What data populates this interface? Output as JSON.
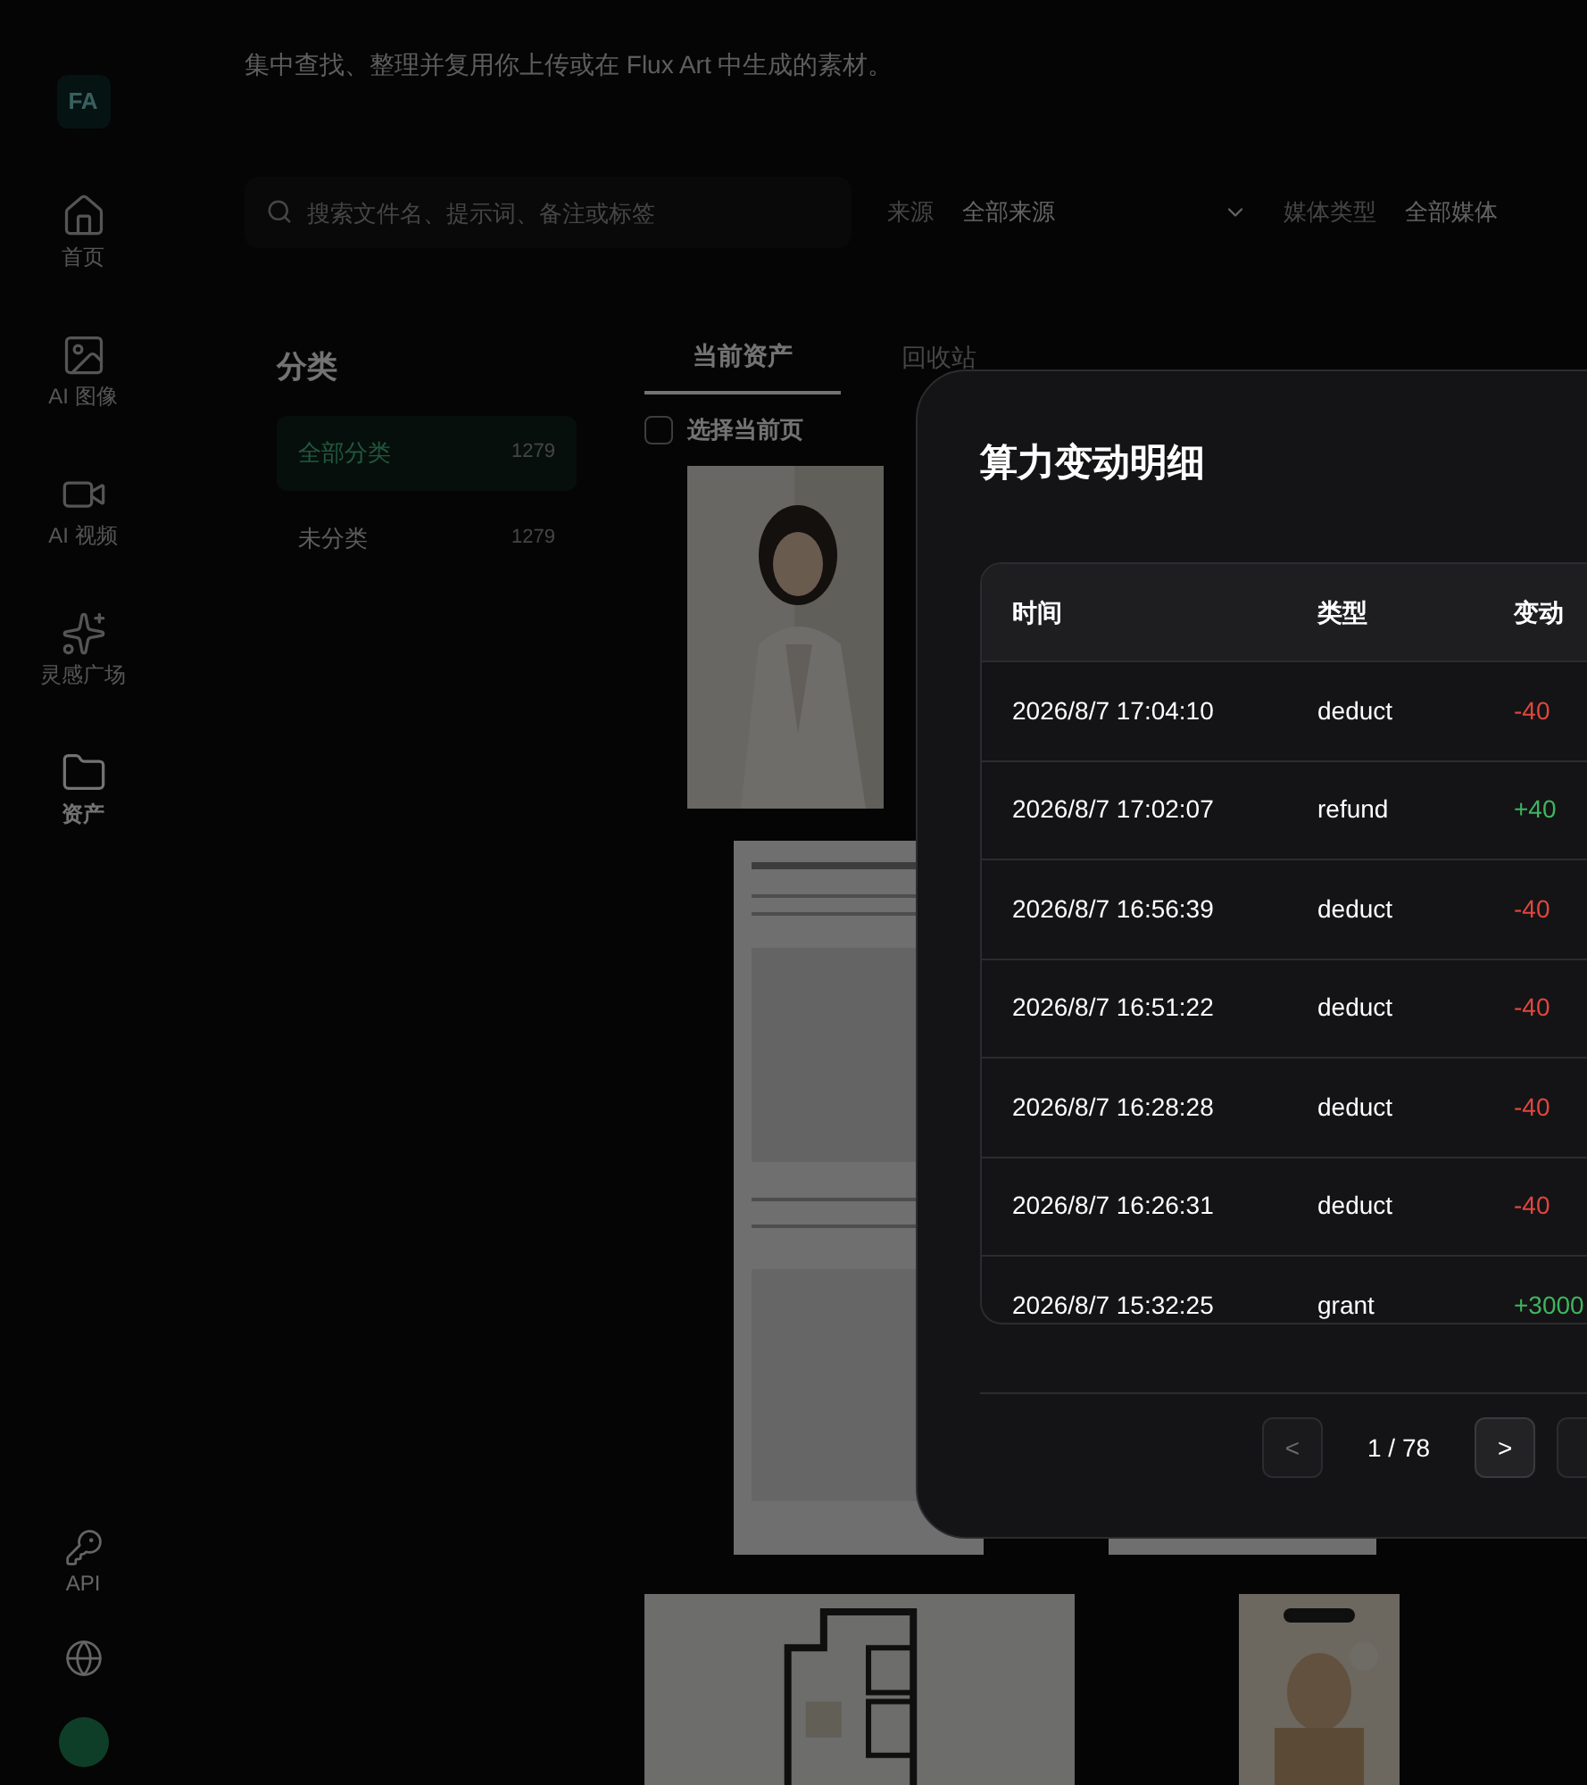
{
  "sidebar": {
    "logo": "FA",
    "items": [
      {
        "label": "首页",
        "selected": false
      },
      {
        "label": "AI 图像",
        "selected": false
      },
      {
        "label": "AI 视频",
        "selected": false
      },
      {
        "label": "灵感广场",
        "selected": false
      },
      {
        "label": "资产",
        "selected": true
      }
    ],
    "bottom": [
      {
        "label": "API"
      }
    ]
  },
  "page": {
    "subtitle": "集中查找、整理并复用你上传或在 Flux Art 中生成的素材。",
    "search": {
      "placeholder": "搜索文件名、提示词、备注或标签"
    },
    "filters": [
      {
        "label": "来源",
        "value": "全部来源"
      },
      {
        "label": "媒体类型",
        "value": "全部媒体"
      }
    ],
    "categories": {
      "title": "分类",
      "items": [
        {
          "name": "全部分类",
          "count": "1279",
          "selected": true
        },
        {
          "name": "未分类",
          "count": "1279",
          "selected": false
        }
      ]
    },
    "tabs": [
      {
        "label": "当前资产",
        "selected": true
      },
      {
        "label": "回收站",
        "selected": false
      }
    ],
    "select_page": {
      "label": "选择当前页",
      "checked": false
    }
  },
  "modal": {
    "title": "算力变动明细",
    "columns": [
      "时间",
      "类型",
      "变动"
    ],
    "rows": [
      {
        "time": "2026/8/7 17:04:10",
        "type": "deduct",
        "change": "-40",
        "kind": "debit"
      },
      {
        "time": "2026/8/7 17:02:07",
        "type": "refund",
        "change": "+40",
        "kind": "credit"
      },
      {
        "time": "2026/8/7 16:56:39",
        "type": "deduct",
        "change": "-40",
        "kind": "debit"
      },
      {
        "time": "2026/8/7 16:51:22",
        "type": "deduct",
        "change": "-40",
        "kind": "debit"
      },
      {
        "time": "2026/8/7 16:28:28",
        "type": "deduct",
        "change": "-40",
        "kind": "debit"
      },
      {
        "time": "2026/8/7 16:26:31",
        "type": "deduct",
        "change": "-40",
        "kind": "debit"
      },
      {
        "time": "2026/8/7 15:32:25",
        "type": "grant",
        "change": "+3000",
        "kind": "credit"
      }
    ],
    "pagination": {
      "prev": "<",
      "page": "1 / 78",
      "next": ">",
      "prev_disabled": true
    }
  }
}
